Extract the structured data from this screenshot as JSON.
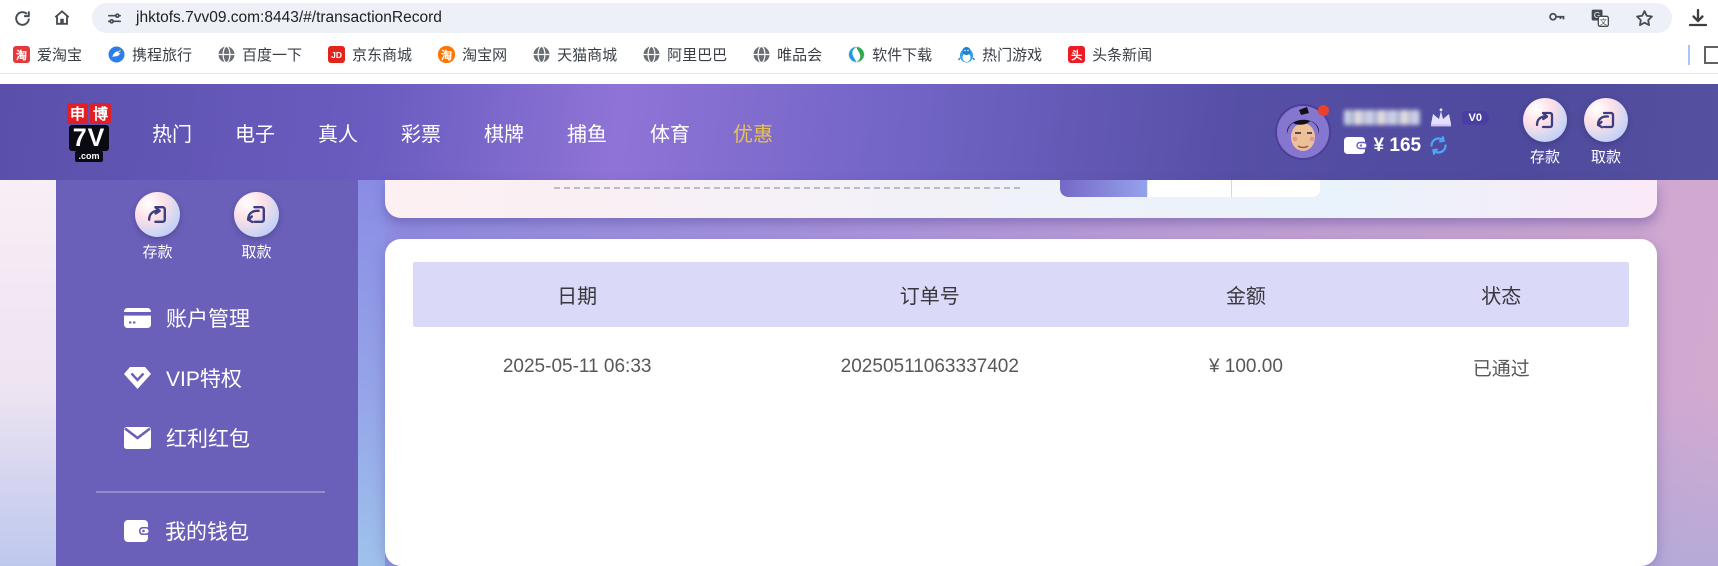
{
  "browser": {
    "url": "jhktofs.7vv09.com:8443/#/transactionRecord",
    "bookmarks": [
      {
        "label": "爱淘宝",
        "glyph": "淘"
      },
      {
        "label": "携程旅行"
      },
      {
        "label": "百度一下"
      },
      {
        "label": "京东商城",
        "glyph": "JD"
      },
      {
        "label": "淘宝网",
        "glyph": "淘"
      },
      {
        "label": "天猫商城"
      },
      {
        "label": "阿里巴巴"
      },
      {
        "label": "唯品会"
      },
      {
        "label": "软件下载"
      },
      {
        "label": "热门游戏"
      },
      {
        "label": "头条新闻",
        "glyph": "头"
      }
    ]
  },
  "header": {
    "logo": {
      "top1": "申",
      "top2": "博",
      "mid": "7V",
      "bottom": ".com"
    },
    "nav": [
      {
        "label": "热门"
      },
      {
        "label": "电子"
      },
      {
        "label": "真人"
      },
      {
        "label": "彩票"
      },
      {
        "label": "棋牌"
      },
      {
        "label": "捕鱼"
      },
      {
        "label": "体育"
      },
      {
        "label": "优惠"
      }
    ],
    "user": {
      "vip_badge": "V0",
      "balance": "¥ 165"
    },
    "actions": {
      "deposit": "存款",
      "withdraw": "取款"
    }
  },
  "sidebar": {
    "quick": {
      "deposit": "存款",
      "withdraw": "取款"
    },
    "menu": [
      {
        "label": "账户管理"
      },
      {
        "label": "VIP特权"
      },
      {
        "label": "红利红包"
      },
      {
        "label": "我的钱包"
      }
    ]
  },
  "table": {
    "columns": [
      "日期",
      "订单号",
      "金额",
      "状态"
    ],
    "rows": [
      {
        "date": "2025-05-11 06:33",
        "order_no": "20250511063337402",
        "amount": "¥ 100.00",
        "status": "已通过"
      }
    ]
  },
  "colors": {
    "header_purple": "#6a5cc0",
    "sidebar_purple": "#6b60b9",
    "nav_active_gold": "#e7c05a",
    "table_header_lavender": "#dbd9f8",
    "status_text": "#57575c",
    "notification_red": "#e8412f",
    "refresh_blue": "#4da6f5"
  }
}
